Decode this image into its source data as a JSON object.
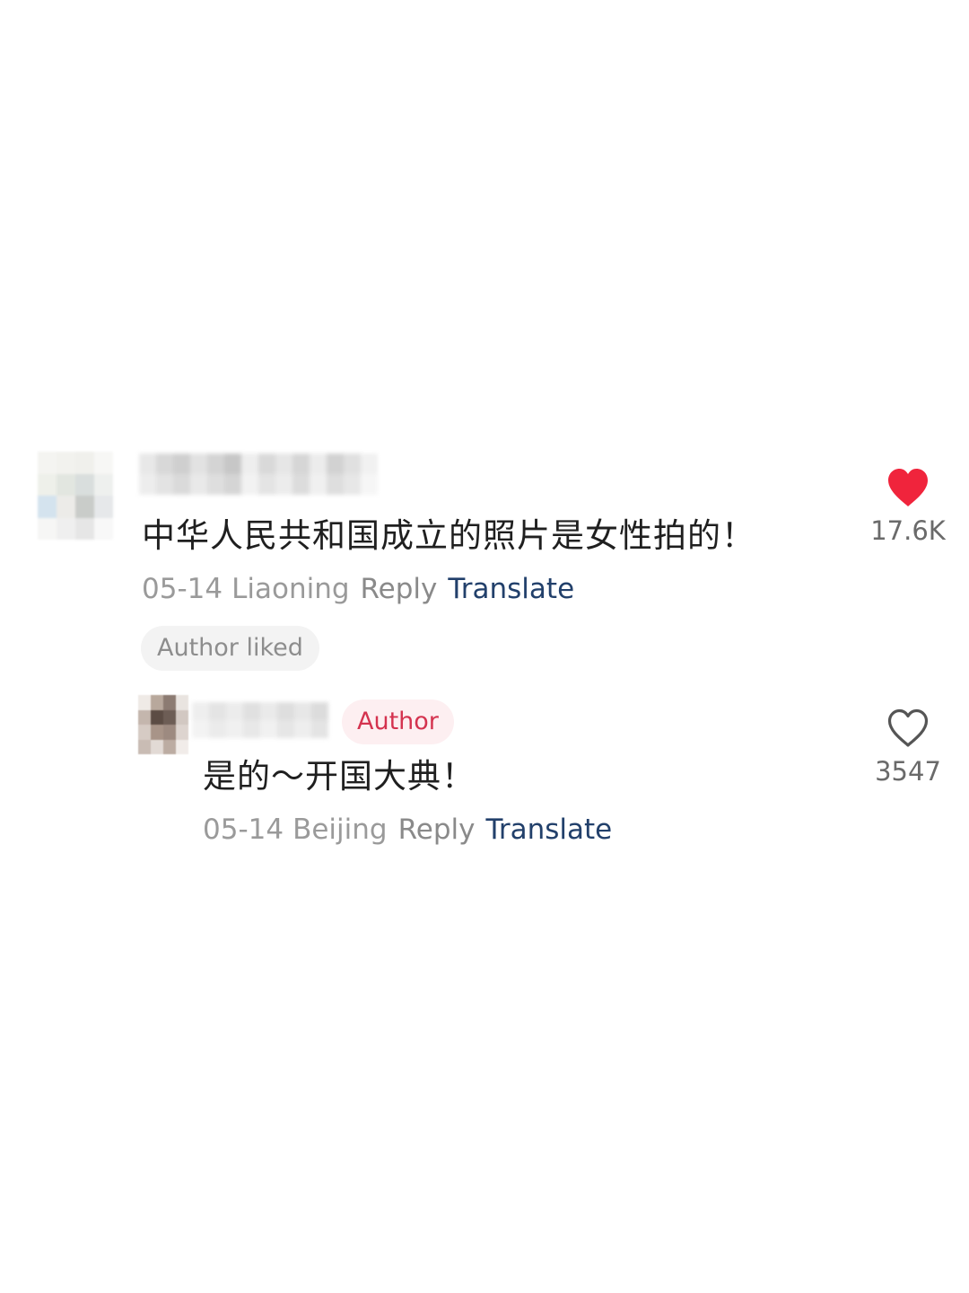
{
  "comment": {
    "text": "中华人民共和国成立的照片是女性拍的！",
    "date": "05-14",
    "location": "Liaoning",
    "reply_label": "Reply",
    "translate_label": "Translate",
    "badge": "Author liked",
    "like_count": "17.6K",
    "liked": true,
    "like_icon": "heart-filled-icon",
    "like_color": "#f0243c"
  },
  "reply": {
    "author_badge": "Author",
    "text": "是的～开国大典！",
    "date": "05-14",
    "location": "Beijing",
    "reply_label": "Reply",
    "translate_label": "Translate",
    "like_count": "3547",
    "liked": false,
    "like_icon": "heart-outline-icon"
  }
}
